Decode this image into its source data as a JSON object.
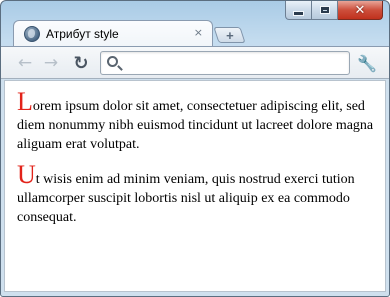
{
  "tab": {
    "title": "Атрибут style",
    "close_glyph": "×",
    "new_tab_glyph": "+"
  },
  "window_controls": {
    "minimize_glyph": "",
    "close_glyph": "✕"
  },
  "toolbar": {
    "back_glyph": "←",
    "forward_glyph": "→",
    "reload_glyph": "↻",
    "address_value": "",
    "address_placeholder": "",
    "menu_glyph": "🔧"
  },
  "content": {
    "paragraphs": [
      {
        "dropcap": "L",
        "text": "orem ipsum dolor sit amet, consectetuer adipiscing elit, sed diem nonummy nibh euismod tincidunt ut lacreet dolore magna aliguam erat volutpat."
      },
      {
        "dropcap": "U",
        "text": "t wisis enim ad minim veniam, quis nostrud exerci tution ullamcorper suscipit lobortis nisl ut aliquip ex ea commodo consequat."
      }
    ]
  },
  "colors": {
    "dropcap": "#e2231a",
    "close_button": "#c0311d"
  },
  "icons": {
    "tab_favicon": "globe-icon",
    "menu": "wrench-icon"
  }
}
